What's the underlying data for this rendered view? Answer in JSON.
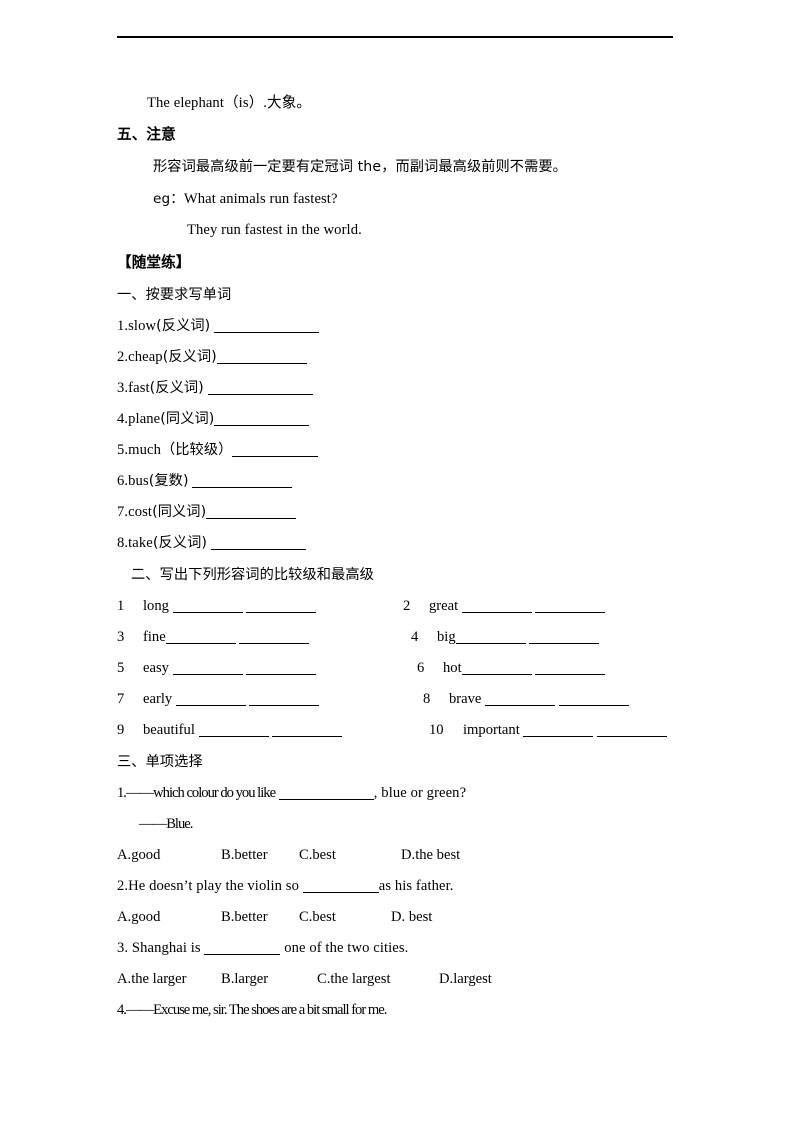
{
  "document": {
    "rule_present": true
  },
  "intro": {
    "example_line": "The elephant（is）.大象。"
  },
  "note_section": {
    "heading": "五、注意",
    "body": "形容词最高级前一定要有定冠词 the，而副词最高级前则不需要。",
    "eg_label": "eg：",
    "eg_question": "What animals run fastest?",
    "eg_answer": "They run fastest in the world."
  },
  "practice": {
    "heading": "【随堂练】",
    "section_one": {
      "heading": "一、按要求写单词",
      "items": [
        {
          "num": "1.",
          "word": "slow",
          "hint": "(反义词)"
        },
        {
          "num": "2.",
          "word": "cheap",
          "hint": "(反义词)"
        },
        {
          "num": "3.",
          "word": "fast",
          "hint": "(反义词)"
        },
        {
          "num": "4.",
          "word": "plane",
          "hint": "(同义词)"
        },
        {
          "num": "5.",
          "word": "much",
          "hint": "（比较级）"
        },
        {
          "num": "6.",
          "word": "bus",
          "hint": "(复数)"
        },
        {
          "num": "7.",
          "word": "cost",
          "hint": "(同义词)"
        },
        {
          "num": "8.",
          "word": "take",
          "hint": "(反义词)"
        }
      ]
    },
    "section_two": {
      "heading": "二、写出下列形容词的比较级和最高级",
      "rows": [
        {
          "left_num": "1",
          "left_word": "long",
          "right_num": "2",
          "right_word": "great"
        },
        {
          "left_num": "3",
          "left_word": "fine",
          "right_num": "4",
          "right_word": "big"
        },
        {
          "left_num": "5",
          "left_word": "easy",
          "right_num": "6",
          "right_word": "hot"
        },
        {
          "left_num": "7",
          "left_word": "early",
          "right_num": "8",
          "right_word": "brave"
        },
        {
          "left_num": "9",
          "left_word": "beautiful",
          "right_num": "10",
          "right_word": "important"
        }
      ]
    },
    "section_three": {
      "heading": "三、单项选择",
      "q1_part1": "1.——which colour do you like",
      "q1_part2": ", blue or green?",
      "q1_reply": "——Blue.",
      "q1_options": [
        "A.good",
        "B.better",
        "C.best",
        "D.the best"
      ],
      "q2_part1": "2.He doesn’t play the violin so",
      "q2_part2": "as his father.",
      "q2_options": [
        "A.good",
        "B.better",
        "C.best",
        "D. best"
      ],
      "q3_part1": "3.  Shanghai is",
      "q3_part2": "one of the two cities.",
      "q3_options": [
        "A.the larger",
        "B.larger",
        "C.the largest",
        "D.largest"
      ],
      "q4": "4.——Excuse me, sir. The shoes are a bit small for me."
    }
  }
}
